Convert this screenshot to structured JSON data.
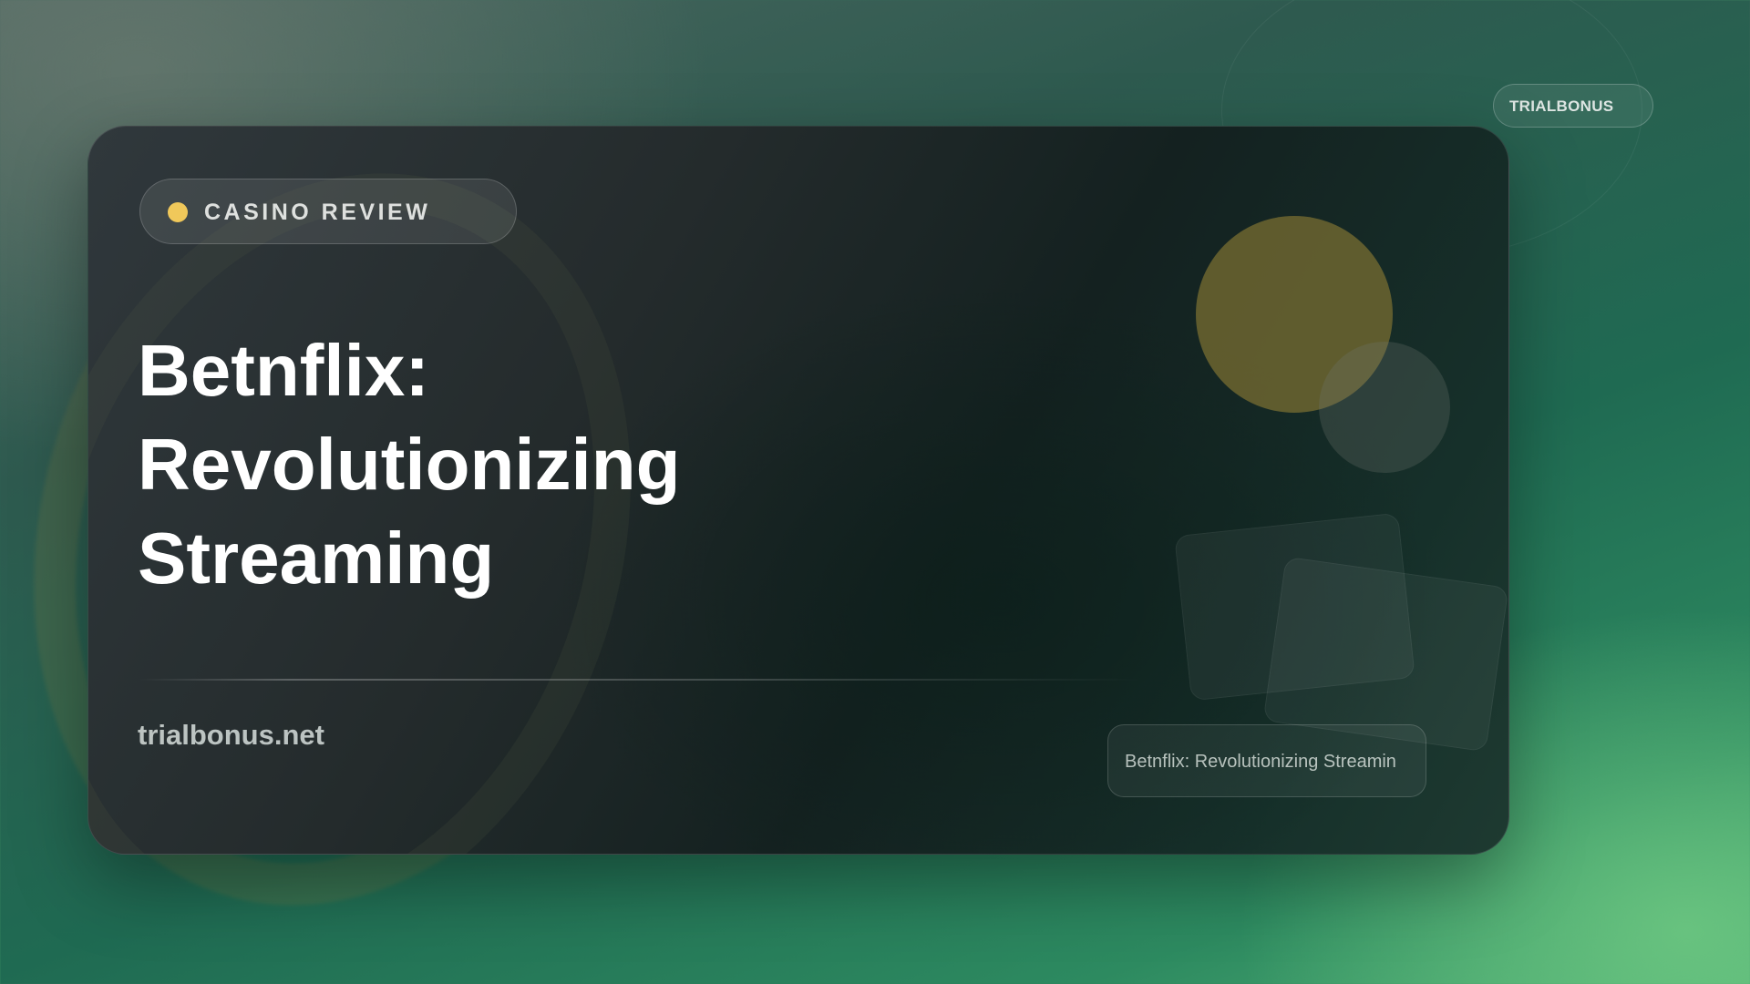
{
  "brand_badge": {
    "label": "TRIALBONUS"
  },
  "card": {
    "category": {
      "label": "CASINO REVIEW",
      "dot_color": "#f0c85a"
    },
    "title_lines": [
      "Betnflix:",
      "Revolutionizing",
      "Streaming"
    ],
    "site_name": "trialbonus.net",
    "footer_chip": "Betnflix: Revolutionizing Streamin"
  },
  "colors": {
    "background_dark": "#1f6a52",
    "background_light": "#4fae74",
    "card_dark": "#142120",
    "accent_gold": "#f0c85a"
  }
}
